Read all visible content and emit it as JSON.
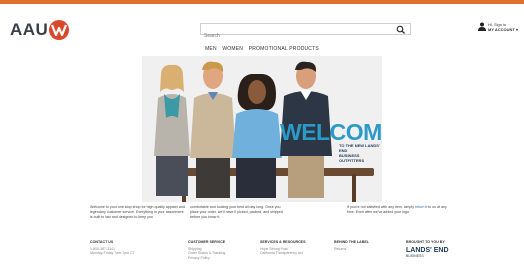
{
  "brand": {
    "logo_text": "AAU",
    "logo_mark_letter": "W"
  },
  "search": {
    "placeholder": "Search"
  },
  "account": {
    "greeting": "Hi, Sign in",
    "label": "MY ACCOUNT"
  },
  "nav": {
    "items": [
      "MEN",
      "WOMEN",
      "PROMOTIONAL PRODUCTS"
    ]
  },
  "hero": {
    "headline": "WELCOME",
    "subline_1": "TO THE NEW LANDS' END",
    "subline_2": "BUSINESS OUTFITTERS"
  },
  "info": {
    "col1": "Welcome to your one stop shop for high quality apparel and legendary customer service. Everything in your assortment is built to last and designed to keep you",
    "col2": "comfortable and looking your best all day long. Once you place your order, we'll have it picked, packed, and shipped before you know it.",
    "col3_pre": "If you're not satisfied with any item, simply",
    "col3_link": "return",
    "col3_post": "it to us at any time. Even after we've added your logo."
  },
  "footer": {
    "contact": {
      "heading": "CONTACT US",
      "phone": "1-800-387-3341",
      "hours": "Monday-Friday 7am-7pm CT"
    },
    "customer_service": {
      "heading": "CUSTOMER SERVICE",
      "links": [
        "Shipping",
        "Order Status & Tracking",
        "Privacy Policy"
      ]
    },
    "services": {
      "heading": "SERVICES & RESOURCES",
      "links": [
        "Hope Strong Post",
        "California Transparency Act"
      ]
    },
    "behind_label": {
      "heading": "BEHIND THE LABEL",
      "links": [
        "Returns"
      ]
    },
    "brought_to_you": {
      "heading": "BROUGHT TO YOU BY",
      "brand": "LANDS' END",
      "brand_sub": "BUSINESS"
    }
  },
  "colors": {
    "accent_bar": "#e0712c",
    "logo_mark": "#d9482b",
    "welcome": "#2a9bc8",
    "navy": "#1d3a56"
  }
}
